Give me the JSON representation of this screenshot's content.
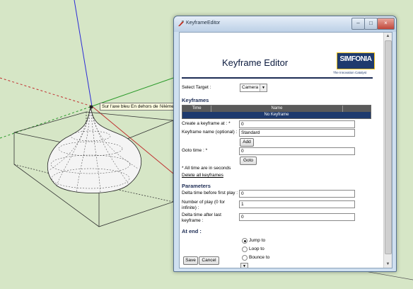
{
  "tooltip": "Sur l'axe bleu En dehors de l'élément actif",
  "window": {
    "title": "KeyframeEditor",
    "controls": {
      "minimize": "–",
      "maximize": "□",
      "close": "×"
    }
  },
  "header": {
    "title": "Keyframe Editor",
    "logo_text": "SIMFONIA",
    "logo_tagline": "The Innovation Catalyst"
  },
  "target": {
    "label": "Select Target :",
    "value": "Camera"
  },
  "keyframes": {
    "section_title": "Keyframes",
    "columns": [
      "Time",
      "Name"
    ],
    "empty_text": "No Keyframe"
  },
  "create": {
    "label": "Create a keyframe at : *",
    "value": "0"
  },
  "name": {
    "label": "Keyframe name (optional) :",
    "value": "Standard"
  },
  "add_button": "Add",
  "goto": {
    "label": "Goto time : *",
    "value": "0",
    "button": "Goto"
  },
  "note": "* All time are in seconds",
  "delete_link": "Delete all keyframes",
  "parameters": {
    "section_title": "Parameters",
    "delta_before": {
      "label": "Delta time before first play :",
      "value": "0"
    },
    "play_count": {
      "label_line1": "Number of play (0 for",
      "label_line2": "infinite) :",
      "value": "1"
    },
    "delta_after": {
      "label_line1": "Delta time after last",
      "label_line2": "keyframe :",
      "value": "0"
    }
  },
  "at_end": {
    "section_title": "At end :",
    "options": [
      {
        "label": "Jump to",
        "selected": true
      },
      {
        "label": "Loop to",
        "selected": false
      },
      {
        "label": "Bounce to",
        "selected": false
      }
    ]
  },
  "footer": {
    "save": "Save",
    "cancel": "Cancel"
  },
  "colors": {
    "viewport_bg": "#d6e6c6",
    "accent": "#1e2d55",
    "logo_bg": "#1e3a6e",
    "logo_border": "#f2c21a"
  }
}
